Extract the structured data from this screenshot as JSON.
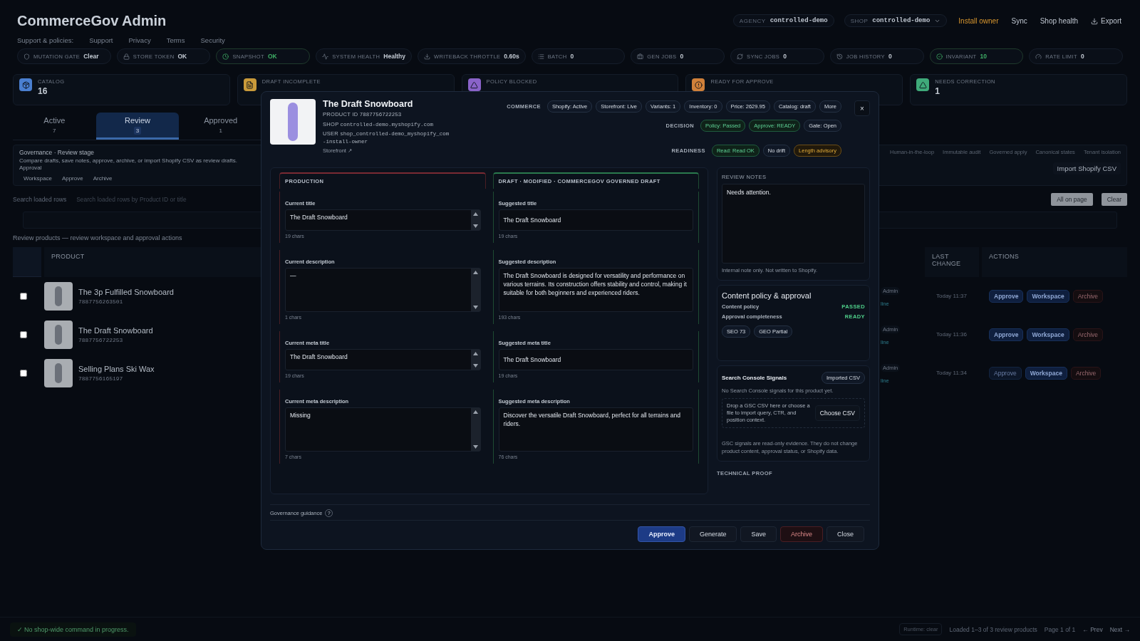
{
  "header": {
    "title": "CommerceGov Admin",
    "links_label": "Support & policies:",
    "links": [
      "Support",
      "Privacy",
      "Terms",
      "Security"
    ],
    "context": [
      {
        "label": "AGENCY",
        "value": "controlled-demo",
        "dropdown": false
      },
      {
        "label": "SHOP",
        "value": "controlled-demo",
        "dropdown": true
      }
    ],
    "actions": [
      {
        "label": "Install owner",
        "kind": "warning"
      },
      {
        "label": "Sync",
        "kind": "plain"
      },
      {
        "label": "Shop health",
        "kind": "plain"
      },
      {
        "label": "Export",
        "kind": "export"
      }
    ]
  },
  "status_chips": [
    {
      "label": "MUTATION GATE",
      "value": "Clear",
      "kind": "neutral"
    },
    {
      "label": "STORE TOKEN",
      "value": "OK",
      "kind": "neutral"
    },
    {
      "label": "SNAPSHOT",
      "value": "OK",
      "kind": "ok"
    },
    {
      "label": "SYSTEM HEALTH",
      "value": "Healthy",
      "kind": "neutral"
    },
    {
      "label": "WRITEBACK THROTTLE",
      "value": "0.60s",
      "kind": "neutral"
    },
    {
      "label": "BATCH",
      "value": "0",
      "kind": "neutral"
    },
    {
      "label": "GEN JOBS",
      "value": "0",
      "kind": "neutral"
    },
    {
      "label": "SYNC JOBS",
      "value": "0",
      "kind": "neutral"
    },
    {
      "label": "JOB HISTORY",
      "value": "0",
      "kind": "neutral"
    },
    {
      "label": "INVARIANT",
      "value": "10",
      "kind": "ok"
    },
    {
      "label": "RATE LIMIT",
      "value": "0",
      "kind": "neutral"
    }
  ],
  "stat_cards": [
    {
      "label": "CATALOG",
      "value": "16",
      "color": "#4a7fd0"
    },
    {
      "label": "DRAFT INCOMPLETE",
      "color": "#c99a3a"
    },
    {
      "label": "POLICY BLOCKED",
      "color": "#8a63c9"
    },
    {
      "label": "READY FOR APPROVE",
      "color": "#d0803a"
    },
    {
      "label": "NEEDS CORRECTION",
      "value": "1",
      "color": "#3faa7a"
    }
  ],
  "tabs": [
    {
      "label": "Active",
      "count": "7",
      "selected": false
    },
    {
      "label": "Review",
      "count": "3",
      "selected": true
    },
    {
      "label": "Approved",
      "count": "1",
      "selected": false
    }
  ],
  "governance": {
    "title": "Governance · Review stage",
    "text": "Compare drafts, save notes, approve, archive, or import Shopify CSV as review drafts. Approval",
    "links": [
      "Workspace",
      "Approve",
      "Archive"
    ],
    "tags": [
      "Human-in-the-loop",
      "Immutable audit",
      "Governed apply",
      "Canonical states",
      "Tenant isolation"
    ],
    "import_button": "Import Shopify CSV"
  },
  "search": {
    "label": "Search loaded rows",
    "placeholder": "Search loaded rows by Product ID or title",
    "buttons": [
      "All on page",
      "Clear"
    ]
  },
  "table": {
    "caption": "Review products — review workspace and approval actions",
    "columns": [
      "PRODUCT",
      "LAST CHANGE",
      "ACTIONS"
    ],
    "rows": [
      {
        "checked": false,
        "name": "The 3p Fulfilled Snowboard",
        "id": "7887756263501",
        "owner": "Admin",
        "status": "line",
        "time": "Today 11:37",
        "actions": [
          {
            "label": "Approve",
            "kind": "approve",
            "disabled": false
          },
          {
            "label": "Workspace",
            "kind": "workspace",
            "disabled": false
          },
          {
            "label": "Archive",
            "kind": "archive",
            "disabled": false
          }
        ]
      },
      {
        "checked": false,
        "name": "The Draft Snowboard",
        "id": "7887756722253",
        "owner": "Admin",
        "status": "line",
        "time": "Today 11:36",
        "actions": [
          {
            "label": "Approve",
            "kind": "approve",
            "disabled": false
          },
          {
            "label": "Workspace",
            "kind": "workspace",
            "disabled": false
          },
          {
            "label": "Archive",
            "kind": "archive",
            "disabled": false
          }
        ]
      },
      {
        "checked": false,
        "name": "Selling Plans Ski Wax",
        "id": "7887756165197",
        "owner": "Admin",
        "status": "line",
        "time": "Today 11:34",
        "actions": [
          {
            "label": "Approve",
            "kind": "approve",
            "disabled": true
          },
          {
            "label": "Workspace",
            "kind": "workspace",
            "disabled": false
          },
          {
            "label": "Archive",
            "kind": "archive",
            "disabled": false
          }
        ]
      }
    ]
  },
  "footer": {
    "status": "✓ No shop-wide command in progress.",
    "runtime": "Runtime: clear",
    "loaded": "Loaded 1–3 of 3 review products",
    "page": "Page 1 of 1",
    "prev": "← Prev",
    "next": "Next →"
  },
  "modal": {
    "title": "The Draft Snowboard",
    "meta": [
      {
        "label": "PRODUCT ID",
        "value": "7887756722253"
      },
      {
        "label": "SHOP",
        "value": "controlled-demo.myshopify.com"
      },
      {
        "label": "USER",
        "value": "shop_controlled-demo_myshopify_com-install-owner"
      }
    ],
    "storefront_link": "Storefront ↗",
    "close": "×",
    "chip_groups": [
      {
        "label": "COMMERCE",
        "chips": [
          {
            "text": "Shopify: Active",
            "kind": "neutral"
          },
          {
            "text": "Storefront: Live",
            "kind": "neutral"
          },
          {
            "text": "Variants: 1",
            "kind": "neutral"
          },
          {
            "text": "Inventory: 0",
            "kind": "neutral"
          },
          {
            "text": "Price: 2629.95",
            "kind": "neutral"
          },
          {
            "text": "Catalog: draft",
            "kind": "neutral"
          }
        ],
        "more": "More"
      },
      {
        "label": "DECISION",
        "chips": [
          {
            "text": "Policy: Passed",
            "kind": "ok"
          },
          {
            "text": "Approve: READY",
            "kind": "ok"
          },
          {
            "text": "Gate: Open",
            "kind": "neutral"
          }
        ]
      },
      {
        "label": "READINESS",
        "chips": [
          {
            "text": "Read: Read OK",
            "kind": "ok"
          },
          {
            "text": "No drift",
            "kind": "neutral"
          },
          {
            "text": "Length advisory",
            "kind": "warn"
          }
        ]
      }
    ],
    "production": {
      "heading": "PRODUCTION",
      "fields": [
        {
          "label": "Current title",
          "value": "The Draft Snowboard",
          "count": "19 chars",
          "kind": "line"
        },
        {
          "label": "Current description",
          "value": "—",
          "count": "1 chars",
          "kind": "multi"
        },
        {
          "label": "Current meta title",
          "value": "The Draft Snowboard",
          "count": "19 chars",
          "kind": "line"
        },
        {
          "label": "Current meta description",
          "value": "Missing",
          "count": "7 chars",
          "kind": "multi"
        }
      ]
    },
    "draft": {
      "heading": "DRAFT · MODIFIED · COMMERCEGOV GOVERNED DRAFT",
      "fields": [
        {
          "label": "Suggested title",
          "value": "The Draft Snowboard",
          "count": "19 chars",
          "kind": "line"
        },
        {
          "label": "Suggested description",
          "value": "The Draft Snowboard is designed for versatility and performance on various terrains. Its construction offers stability and control, making it suitable for both beginners and experienced riders.",
          "count": "193 chars",
          "kind": "multi"
        },
        {
          "label": "Suggested meta title",
          "value": "The Draft Snowboard",
          "count": "19 chars",
          "kind": "line"
        },
        {
          "label": "Suggested meta description",
          "value": "Discover the versatile Draft Snowboard, perfect for all terrains and riders.",
          "count": "76 chars",
          "kind": "multi"
        }
      ]
    },
    "review_notes": {
      "heading": "REVIEW NOTES",
      "value": "Needs attention.",
      "hint": "Internal note only. Not written to Shopify."
    },
    "policy": {
      "title": "Content policy & approval",
      "rows": [
        {
          "label": "Content policy",
          "value": "PASSED"
        },
        {
          "label": "Approval completeness",
          "value": "READY"
        }
      ],
      "chips": [
        "SEO 73",
        "GEO Partial"
      ]
    },
    "signals": {
      "title": "Search Console Signals",
      "badge": "Imported CSV",
      "empty": "No Search Console signals for this product yet.",
      "drop_text": "Drop a GSC CSV here or choose a file to import query, CTR, and position context.",
      "button": "Choose CSV",
      "note": "GSC signals are read-only evidence. They do not change product content, approval status, or Shopify data."
    },
    "technical_proof": "TECHNICAL PROOF",
    "guidance": "Governance guidance",
    "guidance_icon": "?",
    "buttons": [
      {
        "label": "Approve",
        "kind": "primary"
      },
      {
        "label": "Generate",
        "kind": "plain"
      },
      {
        "label": "Save",
        "kind": "plain"
      },
      {
        "label": "Archive",
        "kind": "danger"
      },
      {
        "label": "Close",
        "kind": "plain"
      }
    ]
  }
}
